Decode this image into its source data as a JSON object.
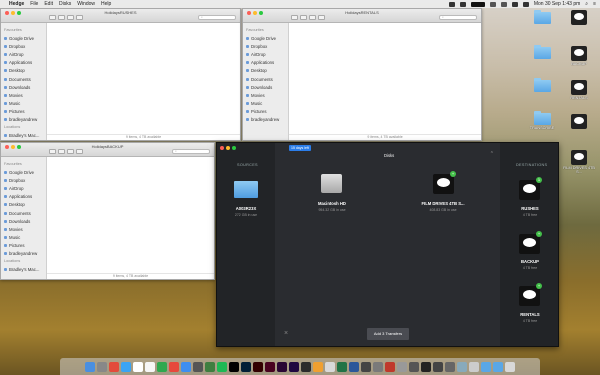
{
  "menubar": {
    "app": "Hedge",
    "items": [
      "File",
      "Edit",
      "Disks",
      "Window",
      "Help"
    ],
    "datetime": "Mon 30 Sep 1:43 pm"
  },
  "windows": [
    {
      "title": "HolidaysRUSHES",
      "status": "9 items, 4 TB available",
      "sidebar_header": "Favourites",
      "locations_header": "Locations",
      "location_item": "Bradley's Mac..."
    },
    {
      "title": "HolidaysRENTALS",
      "status": "9 items, 4 TB available",
      "sidebar_header": "Favourites",
      "locations_header": "",
      "location_item": ""
    },
    {
      "title": "HolidaysBACKUP",
      "status": "9 items, 4 TB available",
      "sidebar_header": "Favourites",
      "locations_header": "Locations",
      "location_item": "Bradley's Mac..."
    }
  ],
  "sidebar_items": [
    "Google Drive",
    "Dropbox",
    "AirDrop",
    "Applications",
    "Desktop",
    "Documents",
    "Downloads",
    "Movies",
    "Music",
    "Pictures",
    "bradleyandrew"
  ],
  "hedge": {
    "trial": "15 days left",
    "sources_header": "SOURCES",
    "disks_header": "Disks",
    "destinations_header": "DESTINATIONS",
    "source": {
      "name": "A003R23X",
      "sub": "272 GB in use"
    },
    "disks": [
      {
        "name": "Macintosh HD",
        "sub": "954.32 GB in use"
      },
      {
        "name": "FILM DRIVES 4TB S...",
        "sub": "408.83 GB in use"
      }
    ],
    "destinations": [
      {
        "name": "RUSHES",
        "sub": "4 TB free",
        "badge": "1"
      },
      {
        "name": "BACKUP",
        "sub": "4 TB free",
        "badge": "+"
      },
      {
        "name": "RENTALS",
        "sub": "4 TB free",
        "badge": "+"
      }
    ],
    "button": "Add 3 Transfers"
  },
  "desktop": {
    "items": [
      "",
      "",
      "BACKUP",
      "",
      "RENTALS",
      "",
      "FILM DRIVES 4TB S...",
      "",
      "TRANSCRIBE",
      ""
    ]
  }
}
